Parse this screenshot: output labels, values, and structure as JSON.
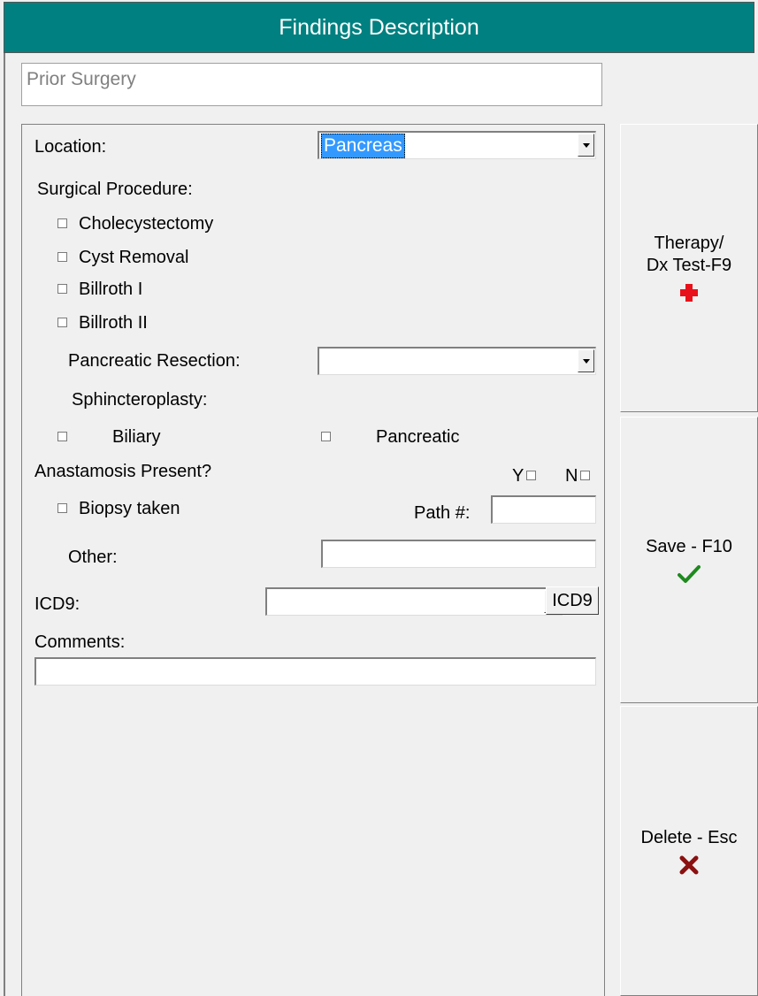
{
  "window": {
    "title": "Findings Description"
  },
  "subject": {
    "value": "Prior Surgery"
  },
  "form": {
    "location_label": "Location:",
    "location_value": "Pancreas",
    "surgical_procedure_label": "Surgical Procedure:",
    "procedures": [
      {
        "label": "Cholecystectomy",
        "checked": false
      },
      {
        "label": "Cyst Removal",
        "checked": false
      },
      {
        "label": "Billroth I",
        "checked": false
      },
      {
        "label": "Billroth II",
        "checked": false
      }
    ],
    "pancreatic_resection_label": "Pancreatic Resection:",
    "pancreatic_resection_value": "",
    "sphincteroplasty_label": "Sphincteroplasty:",
    "biliary_label": "Biliary",
    "pancreatic_label": "Pancreatic",
    "anastamosis_label": "Anastamosis Present?",
    "yes_label": "Y",
    "no_label": "N",
    "biopsy_label": "Biopsy taken",
    "path_label": "Path #:",
    "path_value": "",
    "other_label": "Other:",
    "other_value": "",
    "icd9_label": "ICD9:",
    "icd9_value": "",
    "icd9_button_label": "ICD9",
    "comments_label": "Comments:",
    "comments_value": ""
  },
  "side_buttons": {
    "therapy_label": "Therapy/\nDx Test-F9",
    "therapy_icon": "red-cross-icon",
    "save_label": "Save - F10",
    "save_icon": "green-checkmark-icon",
    "delete_label": "Delete - Esc",
    "delete_icon": "red-x-icon"
  },
  "colors": {
    "titlebar": "#008080",
    "selection": "#3399ff",
    "cross": "#e8101a",
    "check": "#1e8a1e",
    "delete": "#8b1010"
  }
}
